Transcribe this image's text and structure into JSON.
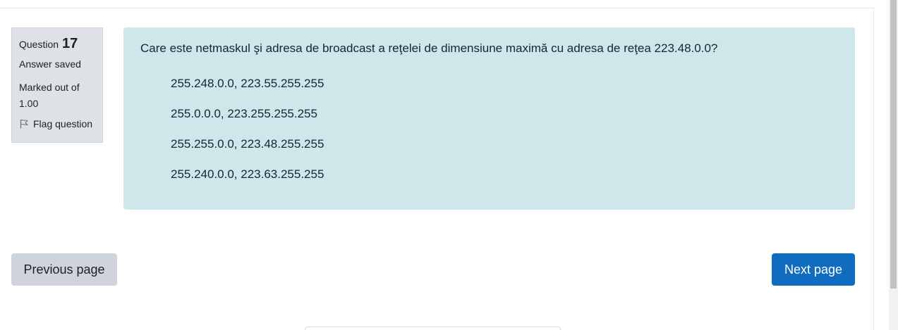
{
  "question_info": {
    "question_word": "Question",
    "question_number": "17",
    "state": "Answer saved",
    "grade": "Marked out of 1.00",
    "flag_label": "Flag question",
    "flag_icon": "flag-outline-icon"
  },
  "question": {
    "text": "Care este netmaskul şi adresa de broadcast a reţelei de dimensiune maximă cu adresa de reţea 223.48.0.0?",
    "options": [
      "255.248.0.0, 223.55.255.255",
      "255.0.0.0, 223.255.255.255",
      "255.255.0.0, 223.48.255.255",
      "255.240.0.0, 223.63.255.255"
    ]
  },
  "navigation": {
    "previous_label": "Previous page",
    "next_label": "Next page"
  },
  "colors": {
    "info_bg": "#dee2e6",
    "content_bg": "#cfe6ea",
    "primary": "#0f6cbf",
    "secondary": "#ced4da"
  }
}
